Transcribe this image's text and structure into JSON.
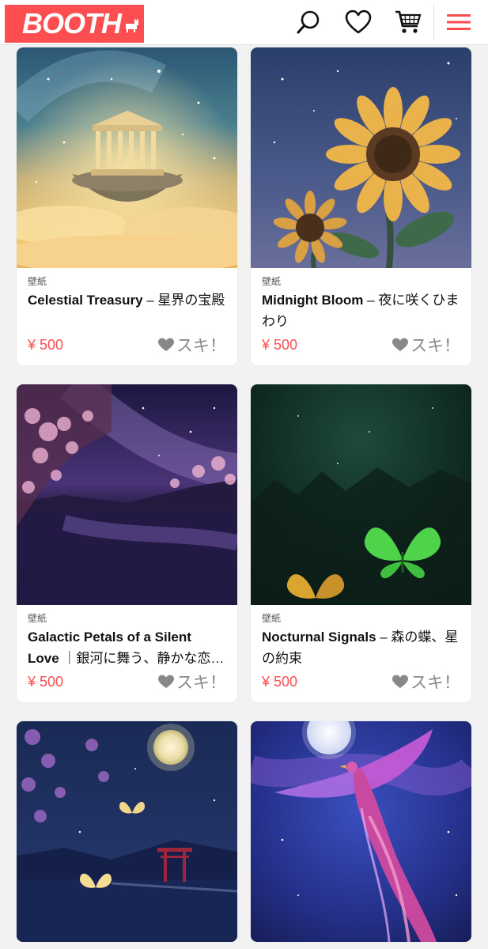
{
  "header": {
    "logo_text": "BOOTH",
    "icons": [
      "search-icon",
      "heart-icon",
      "cart-icon",
      "menu-icon"
    ],
    "brand_color": "#fc4d50"
  },
  "products": [
    {
      "category": "壁紙",
      "title": "Celestial Treasury – 星界の宝殿",
      "price": "¥ 500",
      "like_label": "スキ！",
      "image": "floating-temple-image"
    },
    {
      "category": "壁紙",
      "title": "Midnight Bloom – 夜に咲くひまわり",
      "price": "¥ 500",
      "like_label": "スキ！",
      "image": "sunflower-night-image"
    },
    {
      "category": "壁紙",
      "title": "Galactic Petals of a Silent Love ｜銀河に舞う、静かな恋のは…",
      "price": "¥ 500",
      "like_label": "スキ！",
      "image": "purple-wisteria-lake-image"
    },
    {
      "category": "壁紙",
      "title": "Nocturnal Signals – 森の蝶、星の約束",
      "price": "¥ 500",
      "like_label": "スキ！",
      "image": "glowing-butterflies-forest-image"
    },
    {
      "image": "moon-torii-butterflies-image"
    },
    {
      "image": "phoenix-moon-image"
    }
  ]
}
